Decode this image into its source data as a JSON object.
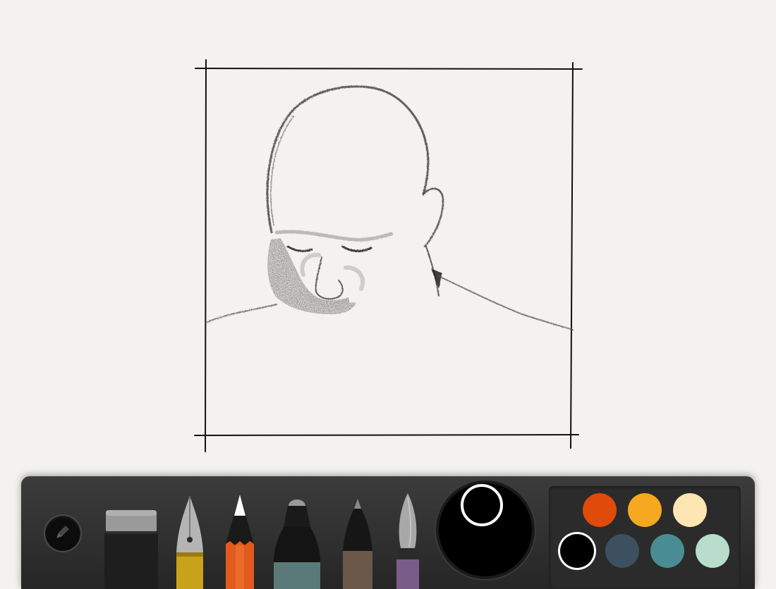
{
  "tools": [
    {
      "name": "eraser",
      "icon": "eraser-icon"
    },
    {
      "name": "fountain-pen",
      "icon": "fountain-pen-icon"
    },
    {
      "name": "pencil",
      "icon": "pencil-icon"
    },
    {
      "name": "marker",
      "icon": "marker-icon"
    },
    {
      "name": "fine-pen",
      "icon": "fine-pen-icon"
    },
    {
      "name": "paintbrush",
      "icon": "paintbrush-icon"
    }
  ],
  "current_color": "#000000",
  "palette": [
    {
      "color": "#e04a0a",
      "selected": false
    },
    {
      "color": "#f5a820",
      "selected": false
    },
    {
      "color": "#fde6b2",
      "selected": false
    },
    {
      "color": "#000000",
      "selected": true
    },
    {
      "color": "#3c5060",
      "selected": false
    },
    {
      "color": "#4a8c94",
      "selected": false
    },
    {
      "color": "#b8ddcc",
      "selected": false
    }
  ]
}
